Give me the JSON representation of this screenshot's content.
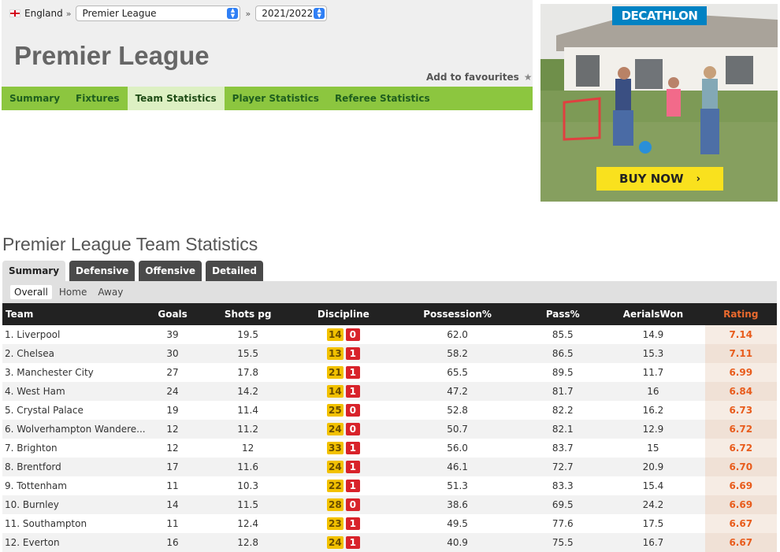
{
  "breadcrumb": {
    "country": "England",
    "separator": "»",
    "league_select": "Premier League",
    "season_select": "2021/2022"
  },
  "header": {
    "title": "Premier League",
    "add_favourites": "Add to favourites"
  },
  "nav": {
    "tabs": [
      "Summary",
      "Fixtures",
      "Team Statistics",
      "Player Statistics",
      "Referee Statistics"
    ],
    "active": "Team Statistics"
  },
  "ad": {
    "brand": "DECATHLON",
    "cta": "BUY NOW",
    "brand_color": "#0082c3",
    "cta_color": "#f9e11e"
  },
  "stats": {
    "title": "Premier League Team Statistics",
    "tabs": [
      "Summary",
      "Defensive",
      "Offensive",
      "Detailed"
    ],
    "active_tab": "Summary",
    "filters": [
      "Overall",
      "Home",
      "Away"
    ],
    "active_filter": "Overall",
    "columns": [
      "Team",
      "Goals",
      "Shots pg",
      "Discipline",
      "Possession%",
      "Pass%",
      "AerialsWon",
      "Rating"
    ],
    "rows": [
      {
        "team": "1. Liverpool",
        "goals": "39",
        "shots": "19.5",
        "yellow": "14",
        "red": "0",
        "possession": "62.0",
        "pass": "85.5",
        "aerials": "14.9",
        "rating": "7.14"
      },
      {
        "team": "2. Chelsea",
        "goals": "30",
        "shots": "15.5",
        "yellow": "13",
        "red": "1",
        "possession": "58.2",
        "pass": "86.5",
        "aerials": "15.3",
        "rating": "7.11"
      },
      {
        "team": "3. Manchester City",
        "goals": "27",
        "shots": "17.8",
        "yellow": "21",
        "red": "1",
        "possession": "65.5",
        "pass": "89.5",
        "aerials": "11.7",
        "rating": "6.99"
      },
      {
        "team": "4. West Ham",
        "goals": "24",
        "shots": "14.2",
        "yellow": "14",
        "red": "1",
        "possession": "47.2",
        "pass": "81.7",
        "aerials": "16",
        "rating": "6.84"
      },
      {
        "team": "5. Crystal Palace",
        "goals": "19",
        "shots": "11.4",
        "yellow": "25",
        "red": "0",
        "possession": "52.8",
        "pass": "82.2",
        "aerials": "16.2",
        "rating": "6.73"
      },
      {
        "team": "6. Wolverhampton Wandere...",
        "goals": "12",
        "shots": "11.2",
        "yellow": "24",
        "red": "0",
        "possession": "50.7",
        "pass": "82.1",
        "aerials": "12.9",
        "rating": "6.72"
      },
      {
        "team": "7. Brighton",
        "goals": "12",
        "shots": "12",
        "yellow": "33",
        "red": "1",
        "possession": "56.0",
        "pass": "83.7",
        "aerials": "15",
        "rating": "6.72"
      },
      {
        "team": "8. Brentford",
        "goals": "17",
        "shots": "11.6",
        "yellow": "24",
        "red": "1",
        "possession": "46.1",
        "pass": "72.7",
        "aerials": "20.9",
        "rating": "6.70"
      },
      {
        "team": "9. Tottenham",
        "goals": "11",
        "shots": "10.3",
        "yellow": "22",
        "red": "1",
        "possession": "51.3",
        "pass": "83.3",
        "aerials": "15.4",
        "rating": "6.69"
      },
      {
        "team": "10. Burnley",
        "goals": "14",
        "shots": "11.5",
        "yellow": "28",
        "red": "0",
        "possession": "38.6",
        "pass": "69.5",
        "aerials": "24.2",
        "rating": "6.69"
      },
      {
        "team": "11. Southampton",
        "goals": "11",
        "shots": "12.4",
        "yellow": "23",
        "red": "1",
        "possession": "49.5",
        "pass": "77.6",
        "aerials": "17.5",
        "rating": "6.67"
      },
      {
        "team": "12. Everton",
        "goals": "16",
        "shots": "12.8",
        "yellow": "24",
        "red": "1",
        "possession": "40.9",
        "pass": "75.5",
        "aerials": "16.7",
        "rating": "6.67"
      }
    ]
  }
}
